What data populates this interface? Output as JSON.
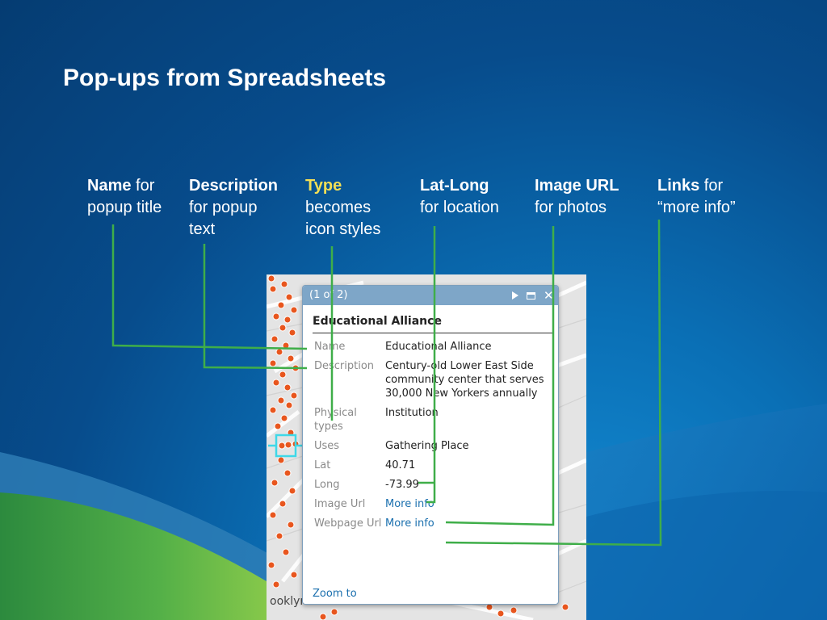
{
  "slide": {
    "title": "Pop-ups from Spreadsheets"
  },
  "fields": [
    {
      "bold": "Name",
      "rest": " for",
      "line2": "popup title",
      "line3": ""
    },
    {
      "bold": "Description",
      "rest": "",
      "line2": "for popup",
      "line3": "text"
    },
    {
      "bold": "Type",
      "rest": "",
      "line2": "becomes",
      "line3": "icon styles"
    },
    {
      "bold": "Lat-Long",
      "rest": "",
      "line2": "for location",
      "line3": ""
    },
    {
      "bold": "Image URL",
      "rest": "",
      "line2": "for photos",
      "line3": ""
    },
    {
      "bold": "Links",
      "rest": " for",
      "line2": "“more info”",
      "line3": ""
    }
  ],
  "map": {
    "label": "ooklyn"
  },
  "popup": {
    "counter": "(1 of 2)",
    "title": "Educational Alliance",
    "rows": [
      {
        "label": "Name",
        "value": "Educational Alliance"
      },
      {
        "label": "Description",
        "value": "Century-old Lower East Side community center that serves 30,000 New Yorkers annually"
      },
      {
        "label": "Physical types",
        "value": "Institution"
      },
      {
        "label": "Uses",
        "value": "Gathering Place"
      },
      {
        "label": "Lat",
        "value": "40.71"
      },
      {
        "label": "Long",
        "value": "-73.99"
      },
      {
        "label": "Image Url",
        "value": "More info"
      },
      {
        "label": "Webpage Url",
        "value": "More info"
      }
    ],
    "zoom_label": "Zoom to"
  },
  "colors": {
    "leader_line": "#3fae49",
    "type_highlight": "#f3df55",
    "popup_header": "#7ea6c8",
    "marker": "#e8561e"
  }
}
